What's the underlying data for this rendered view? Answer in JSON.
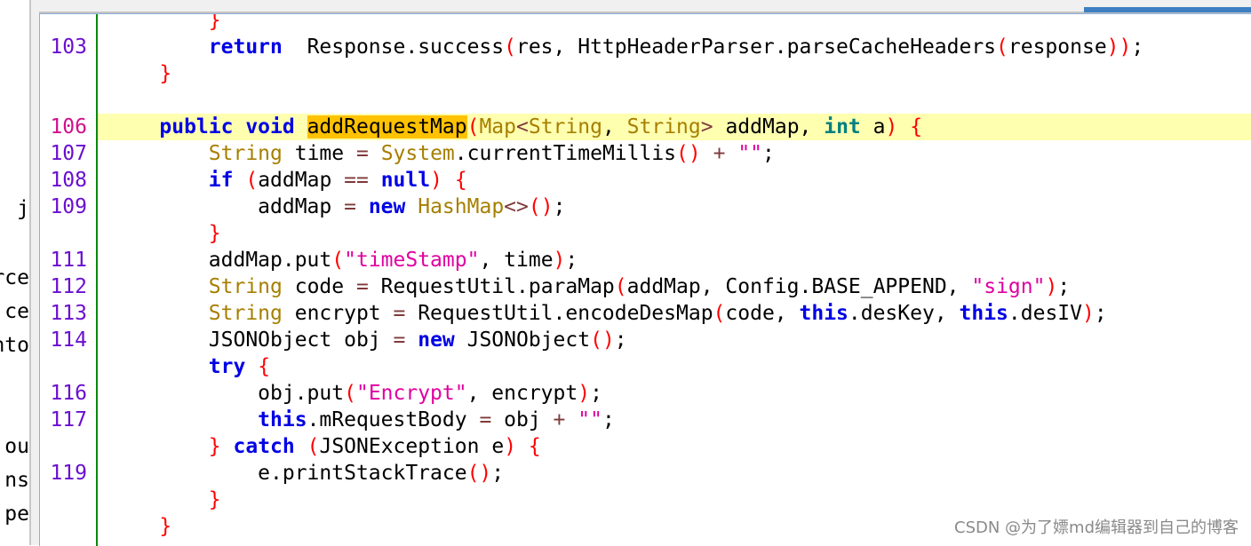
{
  "left_panel_fragments": [
    "j",
    "rce",
    "ce",
    "nto",
    "ou",
    "ns",
    "pe"
  ],
  "colors": {
    "keyword": "#0000e6",
    "type": "#a67f00",
    "primitive": "#008080",
    "operator": "#7f3a3a",
    "paren": "#ff0000",
    "string": "#e000a0",
    "line_number": "#6a0fd0",
    "current_line_number": "#d0108a",
    "current_line_bg": "#ffffb0",
    "occurrence_highlight": "#ffc200",
    "change_bar": "#0a8a0a"
  },
  "editor": {
    "current_line": 106,
    "lines": [
      {
        "num": "",
        "indent": 8,
        "tokens": [
          [
            "p",
            "}"
          ]
        ]
      },
      {
        "num": "103",
        "indent": 8,
        "tokens": [
          [
            "kw",
            "return"
          ],
          [
            "",
            "  Response.success"
          ],
          [
            "p",
            "("
          ],
          [
            "",
            "res, HttpHeaderParser.parseCacheHeaders"
          ],
          [
            "p",
            "("
          ],
          [
            "",
            "response"
          ],
          [
            "p",
            "))"
          ],
          [
            "",
            ";"
          ]
        ]
      },
      {
        "num": "",
        "indent": 4,
        "tokens": [
          [
            "p",
            "}"
          ]
        ]
      },
      {
        "num": "",
        "indent": 0,
        "tokens": []
      },
      {
        "num": "106",
        "indent": 4,
        "tokens": [
          [
            "kw",
            "public void"
          ],
          [
            "",
            " "
          ],
          [
            "mark",
            "addRequestMap"
          ],
          [
            "p",
            "("
          ],
          [
            "ty",
            "Map"
          ],
          [
            "op",
            "<"
          ],
          [
            "ty",
            "String"
          ],
          [
            "",
            ", "
          ],
          [
            "ty",
            "String"
          ],
          [
            "op",
            ">"
          ],
          [
            "",
            " addMap, "
          ],
          [
            "prim",
            "int"
          ],
          [
            "",
            " a"
          ],
          [
            "p",
            ")"
          ],
          [
            "",
            " "
          ],
          [
            "p",
            "{"
          ]
        ]
      },
      {
        "num": "107",
        "indent": 8,
        "tokens": [
          [
            "ty",
            "String"
          ],
          [
            "",
            " time "
          ],
          [
            "op",
            "="
          ],
          [
            "",
            " "
          ],
          [
            "ty",
            "System"
          ],
          [
            "",
            ".currentTimeMillis"
          ],
          [
            "p",
            "()"
          ],
          [
            "",
            " "
          ],
          [
            "op",
            "+"
          ],
          [
            "",
            " "
          ],
          [
            "s",
            "\"\""
          ],
          [
            "",
            ";"
          ]
        ]
      },
      {
        "num": "108",
        "indent": 8,
        "tokens": [
          [
            "kw",
            "if"
          ],
          [
            "",
            " "
          ],
          [
            "p",
            "("
          ],
          [
            "",
            "addMap "
          ],
          [
            "op",
            "=="
          ],
          [
            "",
            " "
          ],
          [
            "kw",
            "null"
          ],
          [
            "p",
            ")"
          ],
          [
            "",
            " "
          ],
          [
            "p",
            "{"
          ]
        ]
      },
      {
        "num": "109",
        "indent": 12,
        "tokens": [
          [
            "",
            "addMap "
          ],
          [
            "op",
            "="
          ],
          [
            "",
            " "
          ],
          [
            "kw",
            "new"
          ],
          [
            "",
            " "
          ],
          [
            "ty",
            "HashMap"
          ],
          [
            "op",
            "<>"
          ],
          [
            "p",
            "()"
          ],
          [
            "",
            ";"
          ]
        ]
      },
      {
        "num": "",
        "indent": 8,
        "tokens": [
          [
            "p",
            "}"
          ]
        ]
      },
      {
        "num": "111",
        "indent": 8,
        "tokens": [
          [
            "",
            "addMap.put"
          ],
          [
            "p",
            "("
          ],
          [
            "s",
            "\"timeStamp\""
          ],
          [
            "",
            ", time"
          ],
          [
            "p",
            ")"
          ],
          [
            "",
            ";"
          ]
        ]
      },
      {
        "num": "112",
        "indent": 8,
        "tokens": [
          [
            "ty",
            "String"
          ],
          [
            "",
            " code "
          ],
          [
            "op",
            "="
          ],
          [
            "",
            " RequestUtil.paraMap"
          ],
          [
            "p",
            "("
          ],
          [
            "",
            "addMap, Config.BASE_APPEND, "
          ],
          [
            "s",
            "\"sign\""
          ],
          [
            "p",
            ")"
          ],
          [
            "",
            ";"
          ]
        ]
      },
      {
        "num": "113",
        "indent": 8,
        "tokens": [
          [
            "ty",
            "String"
          ],
          [
            "",
            " encrypt "
          ],
          [
            "op",
            "="
          ],
          [
            "",
            " RequestUtil.encodeDesMap"
          ],
          [
            "p",
            "("
          ],
          [
            "",
            "code, "
          ],
          [
            "kw",
            "this"
          ],
          [
            "",
            ".desKey, "
          ],
          [
            "kw",
            "this"
          ],
          [
            "",
            ".desIV"
          ],
          [
            "p",
            ")"
          ],
          [
            "",
            ";"
          ]
        ]
      },
      {
        "num": "114",
        "indent": 8,
        "tokens": [
          [
            "",
            "JSONObject obj "
          ],
          [
            "op",
            "="
          ],
          [
            "",
            " "
          ],
          [
            "kw",
            "new"
          ],
          [
            "",
            " JSONObject"
          ],
          [
            "p",
            "()"
          ],
          [
            "",
            ";"
          ]
        ]
      },
      {
        "num": "",
        "indent": 8,
        "tokens": [
          [
            "kw",
            "try"
          ],
          [
            "",
            " "
          ],
          [
            "p",
            "{"
          ]
        ]
      },
      {
        "num": "116",
        "indent": 12,
        "tokens": [
          [
            "",
            "obj.put"
          ],
          [
            "p",
            "("
          ],
          [
            "s",
            "\"Encrypt\""
          ],
          [
            "",
            ", encrypt"
          ],
          [
            "p",
            ")"
          ],
          [
            "",
            ";"
          ]
        ]
      },
      {
        "num": "117",
        "indent": 12,
        "tokens": [
          [
            "kw",
            "this"
          ],
          [
            "",
            ".mRequestBody "
          ],
          [
            "op",
            "="
          ],
          [
            "",
            " obj "
          ],
          [
            "op",
            "+"
          ],
          [
            "",
            " "
          ],
          [
            "s",
            "\"\""
          ],
          [
            "",
            ";"
          ]
        ]
      },
      {
        "num": "",
        "indent": 8,
        "tokens": [
          [
            "p",
            "}"
          ],
          [
            "",
            " "
          ],
          [
            "kw",
            "catch"
          ],
          [
            "",
            " "
          ],
          [
            "p",
            "("
          ],
          [
            "",
            "JSONException e"
          ],
          [
            "p",
            ")"
          ],
          [
            "",
            " "
          ],
          [
            "p",
            "{"
          ]
        ]
      },
      {
        "num": "119",
        "indent": 12,
        "tokens": [
          [
            "",
            "e.printStackTrace"
          ],
          [
            "p",
            "()"
          ],
          [
            "",
            ";"
          ]
        ]
      },
      {
        "num": "",
        "indent": 8,
        "tokens": [
          [
            "p",
            "}"
          ]
        ]
      },
      {
        "num": "",
        "indent": 4,
        "tokens": [
          [
            "p",
            "}"
          ]
        ]
      }
    ]
  },
  "watermark": "CSDN @为了嫖md编辑器到自己的博客"
}
